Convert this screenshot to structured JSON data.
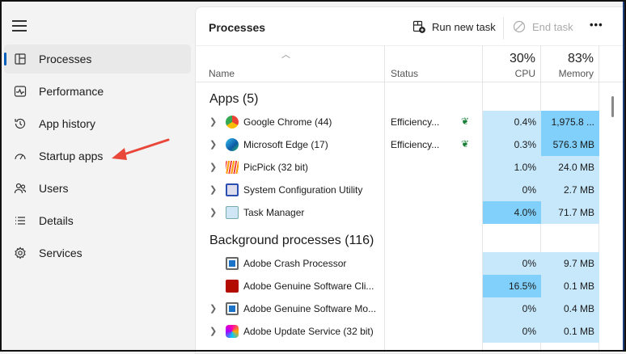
{
  "sidebar": {
    "items": [
      {
        "label": "Processes",
        "icon": "processes-icon",
        "selected": true
      },
      {
        "label": "Performance",
        "icon": "performance-icon"
      },
      {
        "label": "App history",
        "icon": "history-icon"
      },
      {
        "label": "Startup apps",
        "icon": "startup-icon"
      },
      {
        "label": "Users",
        "icon": "users-icon"
      },
      {
        "label": "Details",
        "icon": "details-icon"
      },
      {
        "label": "Services",
        "icon": "services-icon"
      }
    ]
  },
  "header": {
    "title": "Processes",
    "run_new_task": "Run new task",
    "end_task": "End task"
  },
  "columns": {
    "name": "Name",
    "status": "Status",
    "cpu_pct": "30%",
    "cpu": "CPU",
    "mem_pct": "83%",
    "mem": "Memory"
  },
  "groups": {
    "apps": "Apps (5)",
    "background": "Background processes (116)"
  },
  "apps": [
    {
      "name": "Google Chrome (44)",
      "status": "Efficiency...",
      "cpu": "0.4%",
      "mem": "1,975.8 ...",
      "icon": "chrome-icon"
    },
    {
      "name": "Microsoft Edge (17)",
      "status": "Efficiency...",
      "cpu": "0.3%",
      "mem": "576.3 MB",
      "icon": "edge-icon"
    },
    {
      "name": "PicPick (32 bit)",
      "status": "",
      "cpu": "1.0%",
      "mem": "24.0 MB",
      "icon": "picpick-icon"
    },
    {
      "name": "System Configuration Utility",
      "status": "",
      "cpu": "0%",
      "mem": "2.7 MB",
      "icon": "sysconfig-icon"
    },
    {
      "name": "Task Manager",
      "status": "",
      "cpu": "4.0%",
      "mem": "71.7 MB",
      "icon": "taskmanager-icon"
    }
  ],
  "background": [
    {
      "name": "Adobe Crash Processor",
      "cpu": "0%",
      "mem": "9.7 MB"
    },
    {
      "name": "Adobe Genuine Software Cli...",
      "cpu": "16.5%",
      "mem": "0.1 MB"
    },
    {
      "name": "Adobe Genuine Software Mo...",
      "cpu": "0%",
      "mem": "0.4 MB"
    },
    {
      "name": "Adobe Update Service (32 bit)",
      "cpu": "0%",
      "mem": "0.1 MB"
    }
  ],
  "colors": {
    "accent": "#005fb8",
    "cpu_light": "#c7e8fb",
    "cpu_hot": "#80d0fb",
    "arrow": "#e8473a"
  }
}
